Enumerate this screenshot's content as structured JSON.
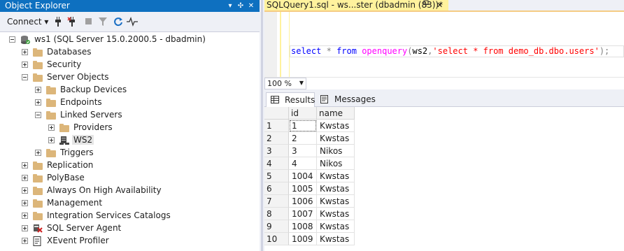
{
  "object_explorer": {
    "title": "Object Explorer",
    "connect_label": "Connect ▾",
    "tree": [
      {
        "label": "ws1 (SQL Server 15.0.2000.5 - dbadmin)",
        "level": 0,
        "expander": "minus",
        "icon": "server-icon"
      },
      {
        "label": "Databases",
        "level": 1,
        "expander": "plus",
        "icon": "folder-icon"
      },
      {
        "label": "Security",
        "level": 1,
        "expander": "plus",
        "icon": "folder-icon"
      },
      {
        "label": "Server Objects",
        "level": 1,
        "expander": "minus",
        "icon": "folder-icon"
      },
      {
        "label": "Backup Devices",
        "level": 2,
        "expander": "plus",
        "icon": "folder-icon"
      },
      {
        "label": "Endpoints",
        "level": 2,
        "expander": "plus",
        "icon": "folder-icon"
      },
      {
        "label": "Linked Servers",
        "level": 2,
        "expander": "minus",
        "icon": "folder-icon"
      },
      {
        "label": "Providers",
        "level": 3,
        "expander": "plus",
        "icon": "folder-icon"
      },
      {
        "label": "WS2",
        "level": 3,
        "expander": "plus",
        "icon": "linked-server-icon",
        "selected": true
      },
      {
        "label": "Triggers",
        "level": 2,
        "expander": "plus",
        "icon": "folder-icon"
      },
      {
        "label": "Replication",
        "level": 1,
        "expander": "plus",
        "icon": "folder-icon"
      },
      {
        "label": "PolyBase",
        "level": 1,
        "expander": "plus",
        "icon": "folder-icon"
      },
      {
        "label": "Always On High Availability",
        "level": 1,
        "expander": "plus",
        "icon": "folder-icon"
      },
      {
        "label": "Management",
        "level": 1,
        "expander": "plus",
        "icon": "folder-icon"
      },
      {
        "label": "Integration Services Catalogs",
        "level": 1,
        "expander": "plus",
        "icon": "folder-icon"
      },
      {
        "label": "SQL Server Agent",
        "level": 1,
        "expander": "plus",
        "icon": "agent-icon"
      },
      {
        "label": "XEvent Profiler",
        "level": 1,
        "expander": "plus",
        "icon": "profiler-icon"
      }
    ]
  },
  "query_tab": {
    "title": "SQLQuery1.sql - ws...ster (dbadmin (83))*",
    "pin_icon": "pin-icon",
    "close_icon": "close-icon"
  },
  "editor": {
    "tokens": [
      {
        "text": "select",
        "cls": "kw"
      },
      {
        "text": " ",
        "cls": "tx"
      },
      {
        "text": "*",
        "cls": "op"
      },
      {
        "text": " ",
        "cls": "tx"
      },
      {
        "text": "from",
        "cls": "kw"
      },
      {
        "text": " ",
        "cls": "tx"
      },
      {
        "text": "openquery",
        "cls": "fn"
      },
      {
        "text": "(",
        "cls": "op"
      },
      {
        "text": "ws2",
        "cls": "tx"
      },
      {
        "text": ",",
        "cls": "op"
      },
      {
        "text": "'select * from demo_db.dbo.users'",
        "cls": "str"
      },
      {
        "text": ");",
        "cls": "op"
      }
    ]
  },
  "zoom": {
    "value": "100 %"
  },
  "results_tabs": [
    {
      "label": "Results",
      "icon": "grid-icon",
      "active": true
    },
    {
      "label": "Messages",
      "icon": "messages-icon",
      "active": false
    }
  ],
  "grid": {
    "columns": [
      "id",
      "name"
    ],
    "rows": [
      {
        "num": "1",
        "id": "1",
        "name": "Kwstas"
      },
      {
        "num": "2",
        "id": "2",
        "name": "Kwstas"
      },
      {
        "num": "3",
        "id": "3",
        "name": "Nikos"
      },
      {
        "num": "4",
        "id": "4",
        "name": "Nikos"
      },
      {
        "num": "5",
        "id": "1004",
        "name": "Kwstas"
      },
      {
        "num": "6",
        "id": "1005",
        "name": "Kwstas"
      },
      {
        "num": "7",
        "id": "1006",
        "name": "Kwstas"
      },
      {
        "num": "8",
        "id": "1007",
        "name": "Kwstas"
      },
      {
        "num": "9",
        "id": "1008",
        "name": "Kwstas"
      },
      {
        "num": "10",
        "id": "1009",
        "name": "Kwstas"
      }
    ]
  },
  "colors": {
    "title_bar": "#0e70c0",
    "tab_active": "#fff29d",
    "keyword": "#0000ff",
    "function": "#ff00ff",
    "string": "#ff0000",
    "operator": "#808080"
  }
}
